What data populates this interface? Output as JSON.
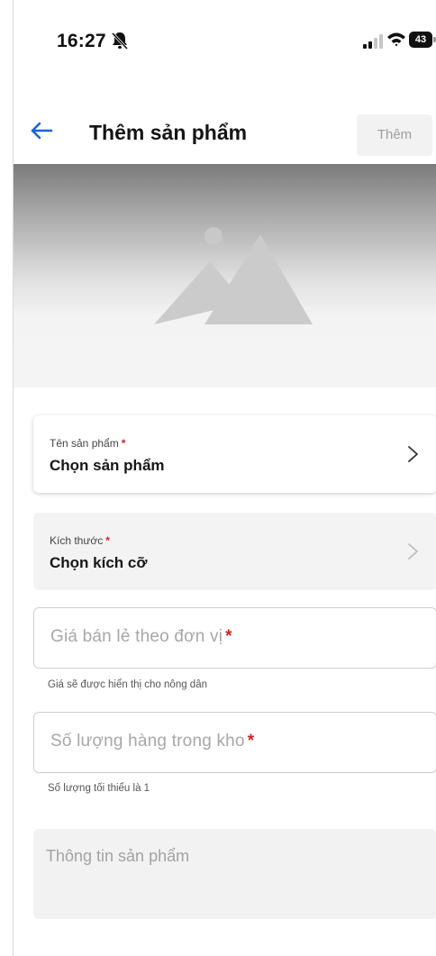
{
  "status_bar": {
    "time": "16:27",
    "battery": "43"
  },
  "header": {
    "title": "Thêm sản phẩm",
    "add_label": "Thêm"
  },
  "form": {
    "product_name": {
      "label": "Tên sản phẩm",
      "required_mark": "*",
      "value": "Chọn sản phẩm"
    },
    "size": {
      "label": "Kích thước",
      "required_mark": "*",
      "value": "Chọn kích cỡ"
    },
    "price": {
      "placeholder": "Giá bán lẻ theo đơn vị",
      "required_mark": "*",
      "helper": "Giá sẽ được hiển thị cho nông dân"
    },
    "stock": {
      "placeholder": "Số lượng hàng trong kho",
      "required_mark": "*",
      "helper": "Số lượng tối thiểu là 1"
    },
    "info": {
      "placeholder": "Thông tin sản phẩm"
    }
  },
  "colors": {
    "accent": "#1565d8",
    "required": "#d0202d"
  },
  "icons": {
    "back": "arrow-left-icon",
    "image": "image-placeholder-icon",
    "chevron": "chevron-right-icon",
    "bell": "bell-off-icon",
    "signal": "signal-icon",
    "wifi": "wifi-icon",
    "battery": "battery-icon"
  }
}
